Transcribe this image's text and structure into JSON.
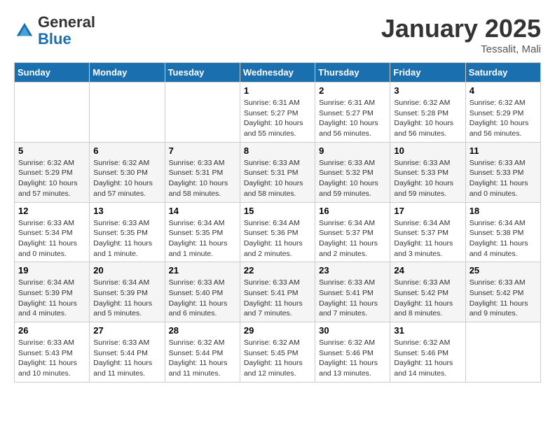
{
  "header": {
    "logo_general": "General",
    "logo_blue": "Blue",
    "month": "January 2025",
    "location": "Tessalit, Mali"
  },
  "days_of_week": [
    "Sunday",
    "Monday",
    "Tuesday",
    "Wednesday",
    "Thursday",
    "Friday",
    "Saturday"
  ],
  "weeks": [
    [
      {
        "day": "",
        "info": ""
      },
      {
        "day": "",
        "info": ""
      },
      {
        "day": "",
        "info": ""
      },
      {
        "day": "1",
        "info": "Sunrise: 6:31 AM\nSunset: 5:27 PM\nDaylight: 10 hours\nand 55 minutes."
      },
      {
        "day": "2",
        "info": "Sunrise: 6:31 AM\nSunset: 5:27 PM\nDaylight: 10 hours\nand 56 minutes."
      },
      {
        "day": "3",
        "info": "Sunrise: 6:32 AM\nSunset: 5:28 PM\nDaylight: 10 hours\nand 56 minutes."
      },
      {
        "day": "4",
        "info": "Sunrise: 6:32 AM\nSunset: 5:29 PM\nDaylight: 10 hours\nand 56 minutes."
      }
    ],
    [
      {
        "day": "5",
        "info": "Sunrise: 6:32 AM\nSunset: 5:29 PM\nDaylight: 10 hours\nand 57 minutes."
      },
      {
        "day": "6",
        "info": "Sunrise: 6:32 AM\nSunset: 5:30 PM\nDaylight: 10 hours\nand 57 minutes."
      },
      {
        "day": "7",
        "info": "Sunrise: 6:33 AM\nSunset: 5:31 PM\nDaylight: 10 hours\nand 58 minutes."
      },
      {
        "day": "8",
        "info": "Sunrise: 6:33 AM\nSunset: 5:31 PM\nDaylight: 10 hours\nand 58 minutes."
      },
      {
        "day": "9",
        "info": "Sunrise: 6:33 AM\nSunset: 5:32 PM\nDaylight: 10 hours\nand 59 minutes."
      },
      {
        "day": "10",
        "info": "Sunrise: 6:33 AM\nSunset: 5:33 PM\nDaylight: 10 hours\nand 59 minutes."
      },
      {
        "day": "11",
        "info": "Sunrise: 6:33 AM\nSunset: 5:33 PM\nDaylight: 11 hours\nand 0 minutes."
      }
    ],
    [
      {
        "day": "12",
        "info": "Sunrise: 6:33 AM\nSunset: 5:34 PM\nDaylight: 11 hours\nand 0 minutes."
      },
      {
        "day": "13",
        "info": "Sunrise: 6:33 AM\nSunset: 5:35 PM\nDaylight: 11 hours\nand 1 minute."
      },
      {
        "day": "14",
        "info": "Sunrise: 6:34 AM\nSunset: 5:35 PM\nDaylight: 11 hours\nand 1 minute."
      },
      {
        "day": "15",
        "info": "Sunrise: 6:34 AM\nSunset: 5:36 PM\nDaylight: 11 hours\nand 2 minutes."
      },
      {
        "day": "16",
        "info": "Sunrise: 6:34 AM\nSunset: 5:37 PM\nDaylight: 11 hours\nand 2 minutes."
      },
      {
        "day": "17",
        "info": "Sunrise: 6:34 AM\nSunset: 5:37 PM\nDaylight: 11 hours\nand 3 minutes."
      },
      {
        "day": "18",
        "info": "Sunrise: 6:34 AM\nSunset: 5:38 PM\nDaylight: 11 hours\nand 4 minutes."
      }
    ],
    [
      {
        "day": "19",
        "info": "Sunrise: 6:34 AM\nSunset: 5:39 PM\nDaylight: 11 hours\nand 4 minutes."
      },
      {
        "day": "20",
        "info": "Sunrise: 6:34 AM\nSunset: 5:39 PM\nDaylight: 11 hours\nand 5 minutes."
      },
      {
        "day": "21",
        "info": "Sunrise: 6:33 AM\nSunset: 5:40 PM\nDaylight: 11 hours\nand 6 minutes."
      },
      {
        "day": "22",
        "info": "Sunrise: 6:33 AM\nSunset: 5:41 PM\nDaylight: 11 hours\nand 7 minutes."
      },
      {
        "day": "23",
        "info": "Sunrise: 6:33 AM\nSunset: 5:41 PM\nDaylight: 11 hours\nand 7 minutes."
      },
      {
        "day": "24",
        "info": "Sunrise: 6:33 AM\nSunset: 5:42 PM\nDaylight: 11 hours\nand 8 minutes."
      },
      {
        "day": "25",
        "info": "Sunrise: 6:33 AM\nSunset: 5:42 PM\nDaylight: 11 hours\nand 9 minutes."
      }
    ],
    [
      {
        "day": "26",
        "info": "Sunrise: 6:33 AM\nSunset: 5:43 PM\nDaylight: 11 hours\nand 10 minutes."
      },
      {
        "day": "27",
        "info": "Sunrise: 6:33 AM\nSunset: 5:44 PM\nDaylight: 11 hours\nand 11 minutes."
      },
      {
        "day": "28",
        "info": "Sunrise: 6:32 AM\nSunset: 5:44 PM\nDaylight: 11 hours\nand 11 minutes."
      },
      {
        "day": "29",
        "info": "Sunrise: 6:32 AM\nSunset: 5:45 PM\nDaylight: 11 hours\nand 12 minutes."
      },
      {
        "day": "30",
        "info": "Sunrise: 6:32 AM\nSunset: 5:46 PM\nDaylight: 11 hours\nand 13 minutes."
      },
      {
        "day": "31",
        "info": "Sunrise: 6:32 AM\nSunset: 5:46 PM\nDaylight: 11 hours\nand 14 minutes."
      },
      {
        "day": "",
        "info": ""
      }
    ]
  ]
}
